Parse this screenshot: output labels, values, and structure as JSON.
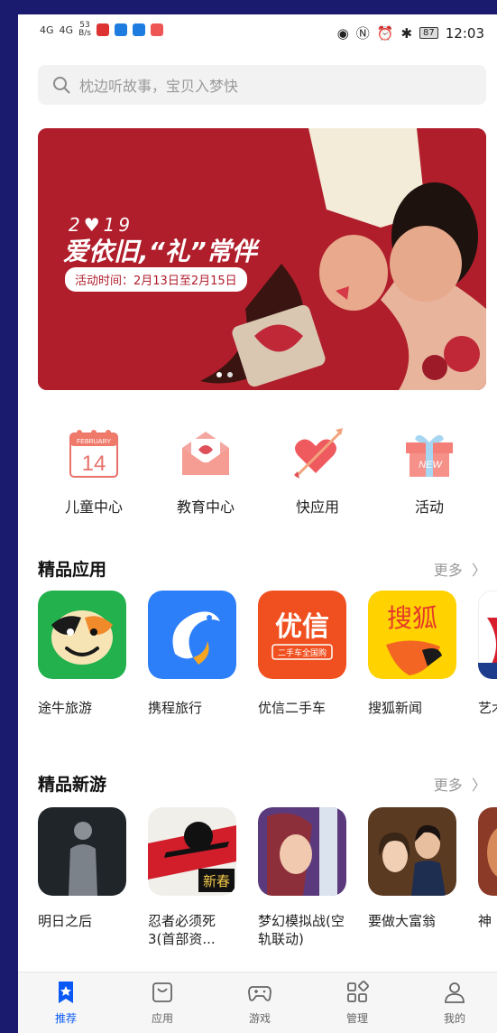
{
  "status_bar": {
    "signal_1": "4G",
    "signal_2": "4G",
    "speed_value": "53",
    "speed_unit": "B/s",
    "battery": "87",
    "time": "12:03"
  },
  "search": {
    "placeholder": "枕边听故事，宝贝入梦快"
  },
  "banner": {
    "year": "2♥19",
    "title": "爱依旧,“礼”常伴",
    "date": "活动时间：2月13日至2月15日",
    "page_count": 2,
    "active_page": 1
  },
  "quick_entries": [
    {
      "label": "儿童中心",
      "icon": "calendar-icon",
      "calendar_month": "FEBRUARY",
      "calendar_day": "14"
    },
    {
      "label": "教育中心",
      "icon": "love-letter-icon"
    },
    {
      "label": "快应用",
      "icon": "heart-arrow-icon"
    },
    {
      "label": "活动",
      "icon": "gift-box-icon",
      "badge": "NEW"
    }
  ],
  "featured_apps": {
    "title": "精品应用",
    "more": "更多",
    "items": [
      {
        "name": "途牛旅游",
        "icon": "tuniu-cow-icon"
      },
      {
        "name": "携程旅行",
        "icon": "ctrip-dolphin-icon"
      },
      {
        "name": "优信二手车",
        "icon": "youxin-icon",
        "icon_text": "优信",
        "icon_subtext": "二手车全国购"
      },
      {
        "name": "搜狐新闻",
        "icon": "sohu-fox-icon",
        "icon_text": "搜狐"
      },
      {
        "name": "艺术",
        "icon": "art-icon"
      }
    ]
  },
  "featured_games": {
    "title": "精品新游",
    "more": "更多",
    "items": [
      {
        "name": "明日之后",
        "icon": "game-survivor-icon"
      },
      {
        "name": "忍者必须死3(首部资...",
        "icon": "game-ninja-icon",
        "icon_text": "新春"
      },
      {
        "name": "梦幻模拟战(空轨联动)",
        "icon": "game-langrisser-icon"
      },
      {
        "name": "要做大富翁",
        "icon": "game-tycoon-icon"
      },
      {
        "name": "神",
        "icon": "game-partial-icon"
      }
    ]
  },
  "bottom_nav": [
    {
      "label": "推荐",
      "icon": "star-bookmark-icon",
      "active": true
    },
    {
      "label": "应用",
      "icon": "app-bag-icon",
      "active": false
    },
    {
      "label": "游戏",
      "icon": "gamepad-icon",
      "active": false
    },
    {
      "label": "管理",
      "icon": "grid-manage-icon",
      "active": false
    },
    {
      "label": "我的",
      "icon": "person-icon",
      "active": false
    }
  ],
  "colors": {
    "accent": "#0a59f7",
    "banner_red": "#b01e2c",
    "frame": "#1a1a6e"
  }
}
